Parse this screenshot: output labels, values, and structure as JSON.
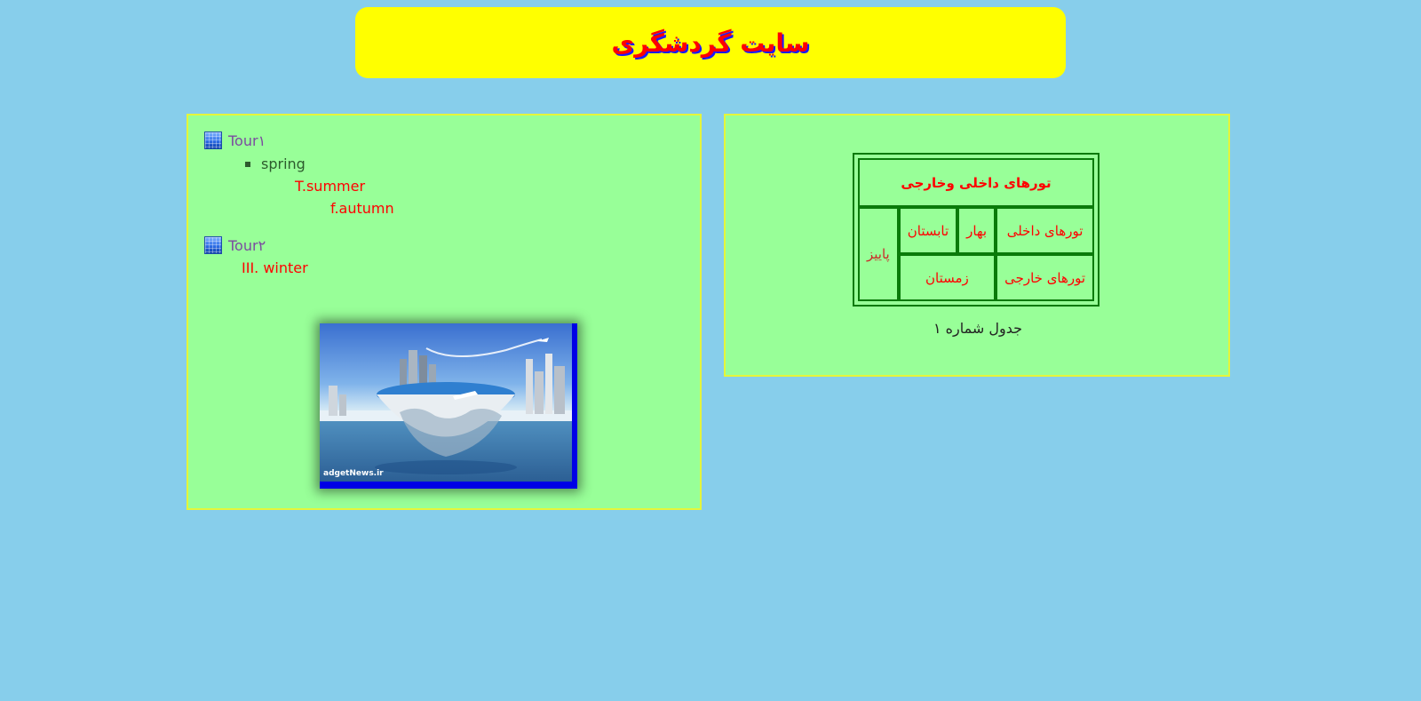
{
  "header": {
    "title": "سایت گردشگری"
  },
  "left_panel": {
    "tour1": {
      "label": "Tour١",
      "items": {
        "spring": "spring",
        "summer": "T.summer",
        "autumn": "f.autumn"
      }
    },
    "tour2": {
      "label": "Tour٢",
      "items": {
        "winter": "III. winter"
      }
    },
    "image": {
      "watermark": "adgetNews.ir"
    }
  },
  "right_panel": {
    "table": {
      "heading": "تورهای داخلی وخارجی",
      "domestic": "تورهای داخلی",
      "spring": "بهار",
      "summer": "تابستان",
      "autumn": "پاییز",
      "foreign": "تورهای خارجی",
      "winter": "زمستان"
    },
    "caption": "جدول شماره ۱"
  },
  "colors": {
    "page_background": "#87ceeb",
    "header_background": "#ffff00",
    "panel_background": "#98ff98",
    "panel_border": "#e5f53a",
    "text_red": "#ff0000",
    "title_shadow": "#1a1aff",
    "table_border": "#0a7a0a"
  }
}
